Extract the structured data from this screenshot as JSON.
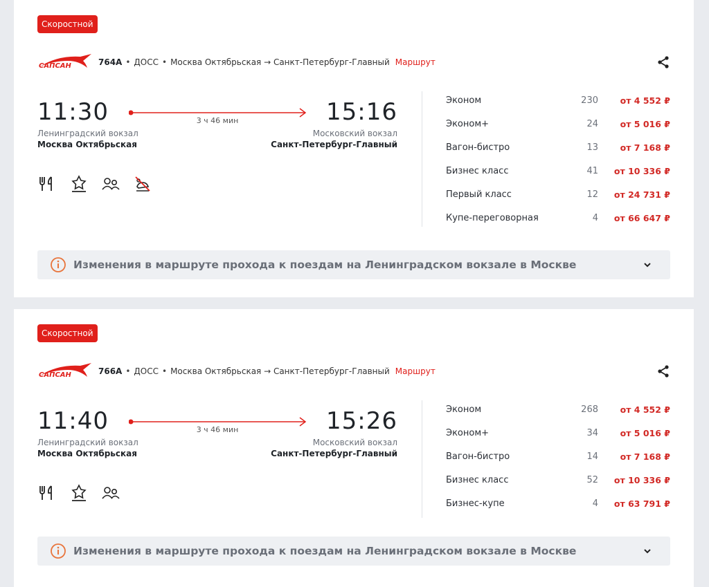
{
  "colors": {
    "accent": "#e0201b",
    "price": "#d22a26",
    "notice_bg": "#eef0f3"
  },
  "trains": [
    {
      "badge": "Скоростной",
      "logo_text": "САПСАН",
      "train_number": "764А",
      "carrier": "ДОСС",
      "route": "Москва Октябрьская → Санкт-Петербург-Главный",
      "route_link": "Маршрут",
      "departure": {
        "time": "11:30",
        "terminal": "Ленинградский вокзал",
        "station": "Москва Октябрьская"
      },
      "arrival": {
        "time": "15:16",
        "terminal": "Московский вокзал",
        "station": "Санкт-Петербург-Главный"
      },
      "duration": "3 ч 46 мин",
      "amenities": [
        "restaurant-icon",
        "loyalty-icon",
        "companions-icon",
        "no-pets-icon"
      ],
      "classes": [
        {
          "name": "Эконом",
          "seats": "230",
          "price": "от 4 552 ₽"
        },
        {
          "name": "Эконом+",
          "seats": "24",
          "price": "от 5 016 ₽"
        },
        {
          "name": "Вагон-бистро",
          "seats": "13",
          "price": "от 7 168 ₽"
        },
        {
          "name": "Бизнес класс",
          "seats": "41",
          "price": "от 10 336 ₽"
        },
        {
          "name": "Первый класс",
          "seats": "12",
          "price": "от 24 731 ₽"
        },
        {
          "name": "Купе-переговорная",
          "seats": "4",
          "price": "от 66 647 ₽"
        }
      ],
      "notice": "Изменения в маршруте прохода к поездам на Ленинградском вокзале в Москве"
    },
    {
      "badge": "Скоростной",
      "logo_text": "САПСАН",
      "train_number": "766А",
      "carrier": "ДОСС",
      "route": "Москва Октябрьская → Санкт-Петербург-Главный",
      "route_link": "Маршрут",
      "departure": {
        "time": "11:40",
        "terminal": "Ленинградский вокзал",
        "station": "Москва Октябрьская"
      },
      "arrival": {
        "time": "15:26",
        "terminal": "Московский вокзал",
        "station": "Санкт-Петербург-Главный"
      },
      "duration": "3 ч 46 мин",
      "amenities": [
        "restaurant-icon",
        "loyalty-icon",
        "companions-icon"
      ],
      "classes": [
        {
          "name": "Эконом",
          "seats": "268",
          "price": "от 4 552 ₽"
        },
        {
          "name": "Эконом+",
          "seats": "34",
          "price": "от 5 016 ₽"
        },
        {
          "name": "Вагон-бистро",
          "seats": "14",
          "price": "от 7 168 ₽"
        },
        {
          "name": "Бизнес класс",
          "seats": "52",
          "price": "от 10 336 ₽"
        },
        {
          "name": "Бизнес-купе",
          "seats": "4",
          "price": "от 63 791 ₽"
        }
      ],
      "notice": "Изменения в маршруте прохода к поездам на Ленинградском вокзале в Москве"
    }
  ]
}
